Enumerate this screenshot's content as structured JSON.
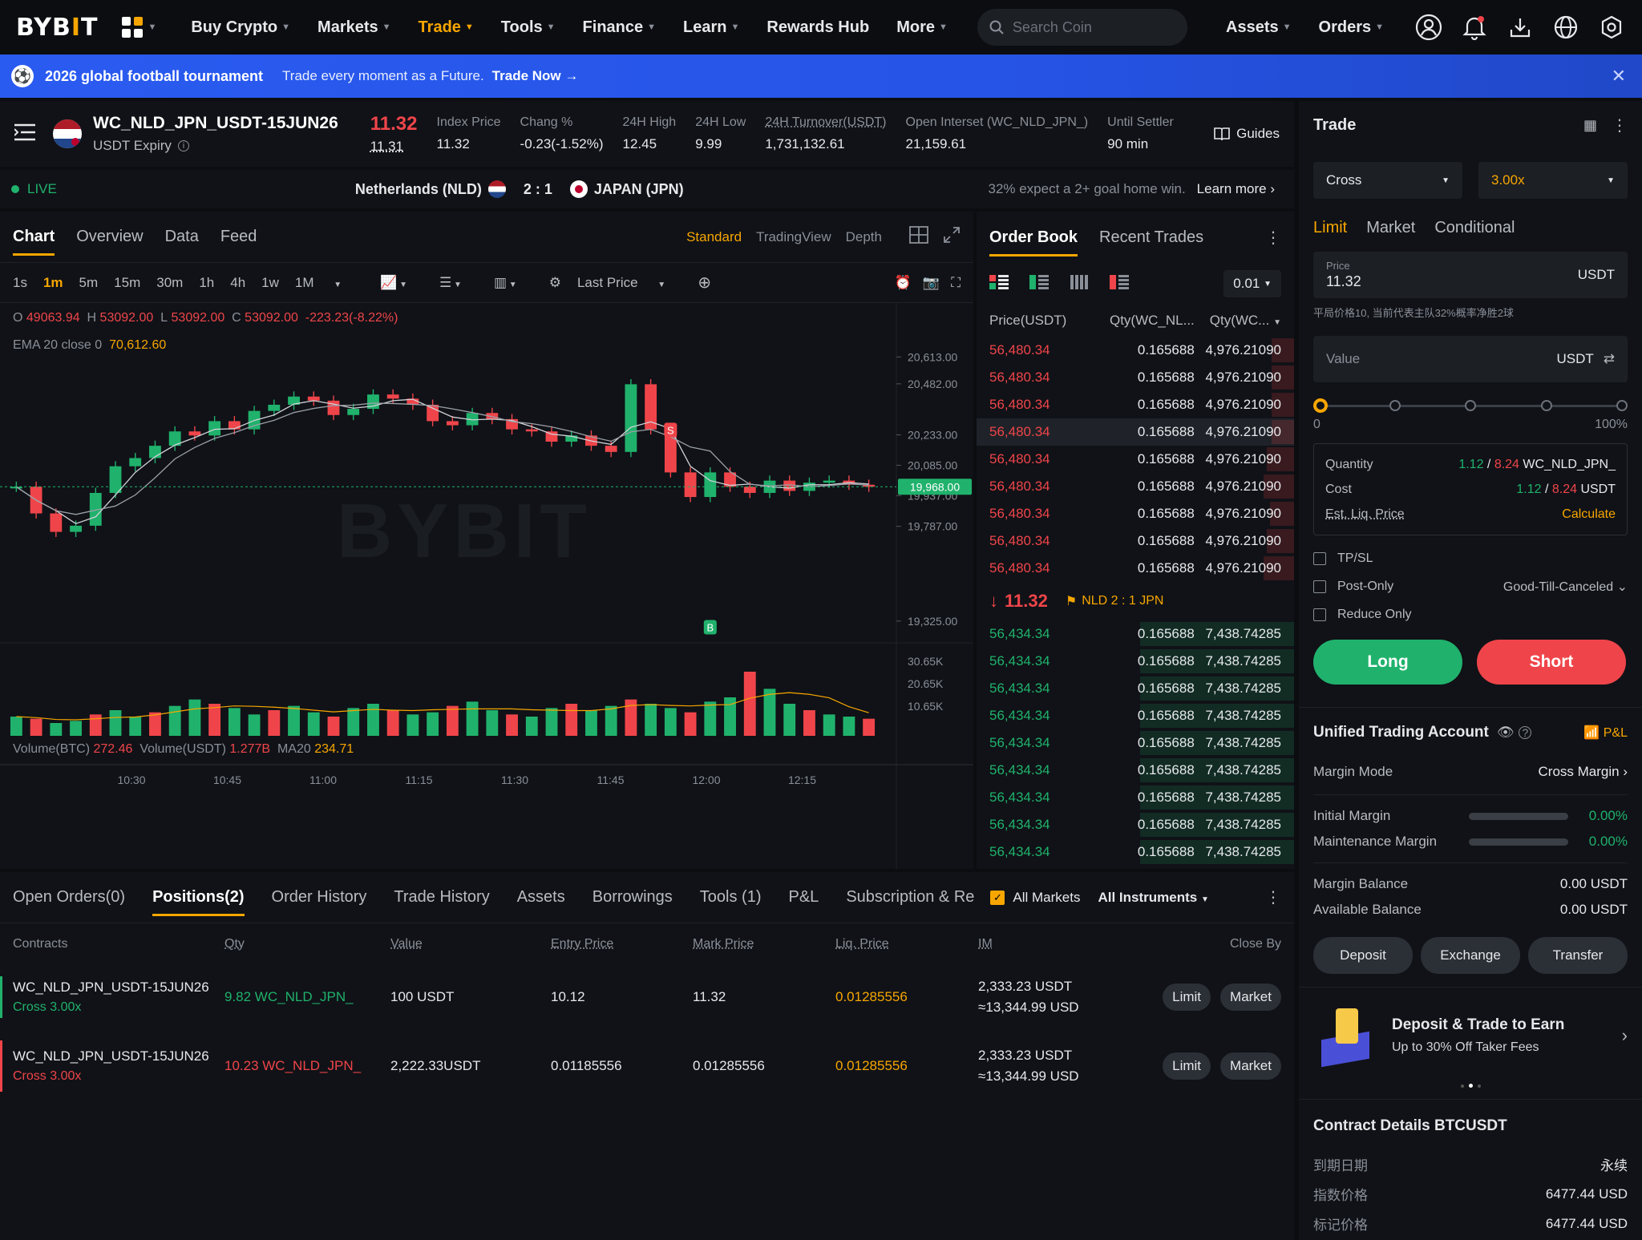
{
  "nav": {
    "logo": "BYB",
    "logo_mid": "I",
    "logo_end": "T",
    "items": [
      "Buy Crypto",
      "Markets",
      "Trade",
      "Tools",
      "Finance",
      "Learn",
      "Rewards Hub",
      "More"
    ],
    "search_placeholder": "Search Coin",
    "assets": "Assets",
    "orders": "Orders"
  },
  "banner": {
    "title": "2026 global football tournament",
    "text": "Trade every moment as a Future.",
    "cta": "Trade Now"
  },
  "ticker": {
    "symbol": "WC_NLD_JPN_USDT-15JUN26",
    "expiry": "USDT Expiry",
    "price": "11.32",
    "mark": "11.31",
    "stats": [
      {
        "label": "Index Price",
        "value": "11.32"
      },
      {
        "label": "Chang %",
        "value": "-0.23(-1.52%)"
      },
      {
        "label": "24H High",
        "value": "12.45"
      },
      {
        "label": "24H Low",
        "value": "9.99"
      },
      {
        "label": "24H Turnover(USDT)",
        "value": "1,731,132.61"
      },
      {
        "label": "Open Interset (WC_NLD_JPN_)",
        "value": "21,159.61"
      },
      {
        "label": "Until Settler",
        "value": "90 min"
      }
    ],
    "guides": "Guides"
  },
  "live": {
    "label": "LIVE",
    "home": "Netherlands (NLD)",
    "score": "2 : 1",
    "away": "JAPAN (JPN)",
    "note": "32% expect a 2+ goal home win.",
    "learn": "Learn more"
  },
  "chart": {
    "tabs": [
      "Chart",
      "Overview",
      "Data",
      "Feed"
    ],
    "views": [
      "Standard",
      "TradingView",
      "Depth"
    ],
    "timeframes": [
      "1s",
      "1m",
      "5m",
      "15m",
      "30m",
      "1h",
      "4h",
      "1w",
      "1M"
    ],
    "last_price": "Last Price",
    "ohlc": {
      "o_label": "O",
      "o": "49063.94",
      "h_label": "H",
      "h": "53092.00",
      "l_label": "L",
      "l": "53092.00",
      "c_label": "C",
      "c": "53092.00",
      "chg": "-223.23(-8.22%)"
    },
    "ema_label": "EMA 20 close 0",
    "ema": "70,612.60",
    "watermark": "BYBIT",
    "vol_btc_label": "Volume(BTC)",
    "vol_btc": "272.46",
    "vol_usdt_label": "Volume(USDT)",
    "vol_usdt": "1.277B",
    "ma_label": "MA20",
    "ma": "234.71",
    "current_price_tag": "19,968.00",
    "markers": {
      "sell": "S",
      "buy": "B"
    }
  },
  "chart_data": {
    "type": "line",
    "title": "",
    "x_ticks": [
      "10:30",
      "10:45",
      "11:00",
      "11:15",
      "11:30",
      "11:45",
      "12:00",
      "12:15"
    ],
    "y_ticks": [
      20613.0,
      20482.0,
      20233.0,
      20085.0,
      19937.0,
      19787.0,
      19325.0
    ],
    "ylim": [
      19250,
      20720
    ],
    "volume_ticks": [
      "30.65K",
      "20.65K",
      "10.65K"
    ],
    "series": [
      {
        "values": [
          19980,
          19850,
          19760,
          19790,
          19950,
          20080,
          20120,
          20180,
          20250,
          20230,
          20300,
          20260,
          20350,
          20380,
          20420,
          20400,
          20330,
          20360,
          20430,
          20410,
          20380,
          20300,
          20280,
          20340,
          20310,
          20260,
          20250,
          20200,
          20230,
          20180,
          20150,
          20480,
          20260,
          20050,
          19930,
          20050,
          19980,
          19950,
          20010,
          19960,
          20000,
          20010,
          19990,
          19980
        ]
      }
    ],
    "volume": [
      9,
      8,
      6,
      7,
      10,
      12,
      9,
      11,
      14,
      17,
      15,
      13,
      10,
      12,
      14,
      11,
      9,
      13,
      15,
      12,
      10,
      11,
      14,
      16,
      12,
      10,
      9,
      13,
      15,
      12,
      14,
      17,
      15,
      13,
      11,
      16,
      18,
      30,
      22,
      15,
      12,
      10,
      9,
      8
    ]
  },
  "orderbook": {
    "tabs": [
      "Order Book",
      "Recent Trades"
    ],
    "precision": "0.01",
    "headers": [
      "Price(USDT)",
      "Qty(WC_NL...",
      "Qty(WC..."
    ],
    "asks": [
      [
        "56,480.34",
        "0.165688",
        "4,976.21090"
      ],
      [
        "56,480.34",
        "0.165688",
        "4,976.21090"
      ],
      [
        "56,480.34",
        "0.165688",
        "4,976.21090"
      ],
      [
        "56,480.34",
        "0.165688",
        "4,976.21090"
      ],
      [
        "56,480.34",
        "0.165688",
        "4,976.21090"
      ],
      [
        "56,480.34",
        "0.165688",
        "4,976.21090"
      ],
      [
        "56,480.34",
        "0.165688",
        "4,976.21090"
      ],
      [
        "56,480.34",
        "0.165688",
        "4,976.21090"
      ],
      [
        "56,480.34",
        "0.165688",
        "4,976.21090"
      ]
    ],
    "mid_price": "11.32",
    "mid_note": "NLD 2 : 1 JPN",
    "bids": [
      [
        "56,434.34",
        "0.165688",
        "7,438.74285"
      ],
      [
        "56,434.34",
        "0.165688",
        "7,438.74285"
      ],
      [
        "56,434.34",
        "0.165688",
        "7,438.74285"
      ],
      [
        "56,434.34",
        "0.165688",
        "7,438.74285"
      ],
      [
        "56,434.34",
        "0.165688",
        "7,438.74285"
      ],
      [
        "56,434.34",
        "0.165688",
        "7,438.74285"
      ],
      [
        "56,434.34",
        "0.165688",
        "7,438.74285"
      ],
      [
        "56,434.34",
        "0.165688",
        "7,438.74285"
      ],
      [
        "56,434.34",
        "0.165688",
        "7,438.74285"
      ]
    ]
  },
  "positions": {
    "tabs": [
      "Open Orders(0)",
      "Positions(2)",
      "Order History",
      "Trade History",
      "Assets",
      "Borrowings",
      "Tools (1)",
      "P&L",
      "Subscription & Re"
    ],
    "all_markets": "All Markets",
    "all_instruments": "All Instruments",
    "headers": [
      "Contracts",
      "Qty",
      "Value",
      "Entry Price",
      "Mark Price",
      "Liq. Price",
      "IM",
      "Close By"
    ],
    "rows": [
      {
        "contract": "WC_NLD_JPN_USDT-15JUN26",
        "mode": "Cross 3.00x",
        "side": "long",
        "qty": "9.82 WC_NLD_JPN_",
        "value": "100 USDT",
        "entry": "10.12",
        "mark": "11.32",
        "liq": "0.01285556",
        "im1": "2,333.23 USDT",
        "im2": "≈13,344.99 USD"
      },
      {
        "contract": "WC_NLD_JPN_USDT-15JUN26",
        "mode": "Cross 3.00x",
        "side": "short",
        "qty": "10.23 WC_NLD_JPN_",
        "value": "2,222.33USDT",
        "entry": "0.01185556",
        "mark": "0.01285556",
        "liq": "0.01285556",
        "im1": "2,333.23 USDT",
        "im2": "≈13,344.99 USD"
      }
    ],
    "limit": "Limit",
    "market": "Market"
  },
  "trade": {
    "title": "Trade",
    "margin_mode": "Cross",
    "leverage": "3.00x",
    "order_types": [
      "Limit",
      "Market",
      "Conditional"
    ],
    "price_label": "Price",
    "price": "11.32",
    "unit": "USDT",
    "price_hint": "平局价格10, 当前代表主队32%概率净胜2球",
    "value_placeholder": "Value",
    "slider_min": "0",
    "slider_max": "100%",
    "slider_level": 0,
    "quantity_label": "Quantity",
    "qty_a": "1.12",
    "qty_b": "8.24",
    "qty_unit": "WC_NLD_JPN_",
    "cost_label": "Cost",
    "cost_a": "1.12",
    "cost_b": "8.24",
    "cost_unit": "USDT",
    "liq_label": "Est. Liq. Price",
    "calculate": "Calculate",
    "tpsl": "TP/SL",
    "post_only": "Post-Only",
    "gtc": "Good-Till-Canceled",
    "reduce_only": "Reduce Only",
    "long": "Long",
    "short": "Short"
  },
  "account": {
    "title": "Unified Trading Account",
    "pnl": "P&L",
    "margin_mode_label": "Margin Mode",
    "margin_mode": "Cross Margin",
    "initial_margin_label": "Initial Margin",
    "initial_margin": "0.00%",
    "maint_margin_label": "Maintenance Margin",
    "maint_margin": "0.00%",
    "margin_balance_label": "Margin Balance",
    "margin_balance": "0.00 USDT",
    "available_label": "Available Balance",
    "available": "0.00 USDT",
    "deposit": "Deposit",
    "exchange": "Exchange",
    "transfer": "Transfer",
    "promo_title": "Deposit & Trade to Earn",
    "promo_sub": "Up to 30% Off Taker Fees"
  },
  "contract": {
    "title": "Contract Details BTCUSDT",
    "rows": [
      {
        "label": "到期日期",
        "value": "永续"
      },
      {
        "label": "指数价格",
        "value": "6477.44 USD"
      },
      {
        "label": "标记价格",
        "value": "6477.44 USD"
      }
    ]
  },
  "colors": {
    "accent": "#f7a600",
    "up": "#20b26c",
    "down": "#ef454a",
    "banner": "#2a5bf0"
  }
}
